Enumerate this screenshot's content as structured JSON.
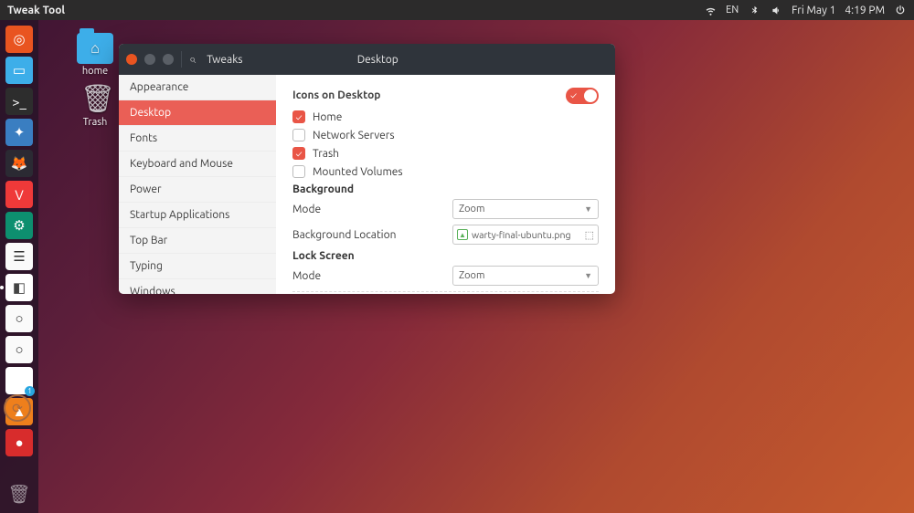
{
  "topbar": {
    "title": "Tweak Tool",
    "lang": "EN",
    "date": "Fri May 1",
    "time": "4:19 PM"
  },
  "desktop_icons": {
    "home": "home",
    "trash": "Trash"
  },
  "window": {
    "app_name": "Tweaks",
    "title": "Desktop",
    "sidebar": [
      "Appearance",
      "Desktop",
      "Fonts",
      "Keyboard and Mouse",
      "Power",
      "Startup Applications",
      "Top Bar",
      "Typing",
      "Windows"
    ],
    "sidebar_active": 1,
    "icons_on_desktop": {
      "heading": "Icons on Desktop",
      "home": "Home",
      "network": "Network Servers",
      "trash": "Trash",
      "mounted": "Mounted Volumes"
    },
    "background": {
      "heading": "Background",
      "mode_label": "Mode",
      "mode_value": "Zoom",
      "location_label": "Background Location",
      "location_value": "warty-final-ubuntu.png"
    },
    "lockscreen": {
      "heading": "Lock Screen",
      "mode_label": "Mode",
      "mode_value": "Zoom"
    }
  }
}
